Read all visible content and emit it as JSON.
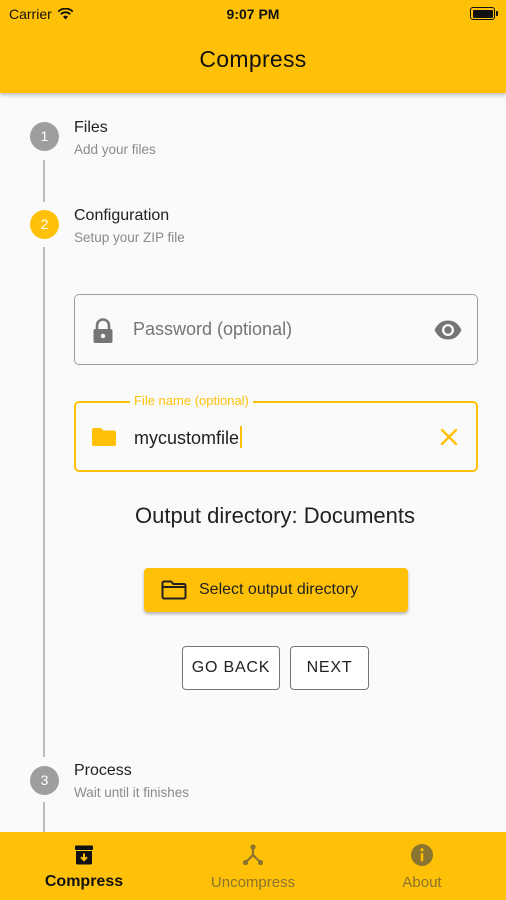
{
  "status_bar": {
    "carrier": "Carrier",
    "time": "9:07 PM"
  },
  "app_bar": {
    "title": "Compress"
  },
  "steps": [
    {
      "number": "1",
      "title": "Files",
      "subtitle": "Add your files"
    },
    {
      "number": "2",
      "title": "Configuration",
      "subtitle": "Setup your ZIP file"
    },
    {
      "number": "3",
      "title": "Process",
      "subtitle": "Wait until it finishes"
    }
  ],
  "password_field": {
    "placeholder": "Password (optional)"
  },
  "filename_field": {
    "label": "File name (optional)",
    "value": "mycustomfile"
  },
  "output_directory": {
    "text": "Output directory: Documents"
  },
  "buttons": {
    "select_output": "Select output directory",
    "go_back": "GO BACK",
    "next": "NEXT"
  },
  "bottom_nav": [
    {
      "label": "Compress",
      "icon": "archive-icon",
      "active": true
    },
    {
      "label": "Uncompress",
      "icon": "branch-icon",
      "active": false
    },
    {
      "label": "About",
      "icon": "info-icon",
      "active": false
    }
  ],
  "colors": {
    "accent": "#ffc107",
    "step_inactive": "#9e9e9e",
    "background": "#fafafa"
  }
}
